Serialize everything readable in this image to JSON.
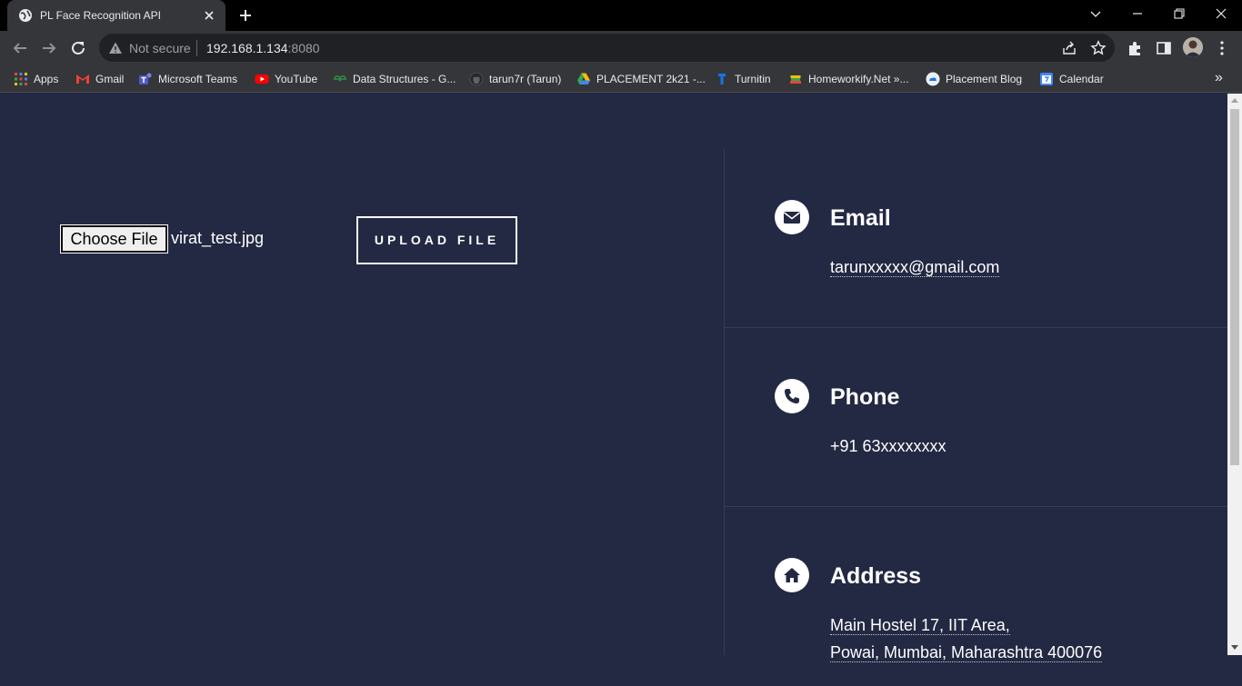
{
  "browser": {
    "tab_title": "PL Face Recognition API",
    "security_label": "Not secure",
    "url_host": "192.168.1.134",
    "url_port": ":8080",
    "bookmarks": [
      {
        "label": "Apps",
        "icon": "apps-grid-icon"
      },
      {
        "label": "Gmail",
        "icon": "gmail-icon"
      },
      {
        "label": "Microsoft Teams",
        "icon": "teams-icon"
      },
      {
        "label": "YouTube",
        "icon": "youtube-icon"
      },
      {
        "label": "Data Structures - G...",
        "icon": "gfg-icon"
      },
      {
        "label": "tarun7r (Tarun)",
        "icon": "github-icon"
      },
      {
        "label": "PLACEMENT 2k21 -...",
        "icon": "drive-icon"
      },
      {
        "label": "Turnitin",
        "icon": "turnitin-icon"
      },
      {
        "label": "Homeworkify.Net »...",
        "icon": "books-icon"
      },
      {
        "label": "Placement Blog",
        "icon": "blog-icon"
      },
      {
        "label": "Calendar",
        "icon": "calendar-icon"
      }
    ]
  },
  "upload": {
    "choose_label": "Choose File",
    "file_name": "virat_test.jpg",
    "upload_label": "UPLOAD FILE"
  },
  "contact": {
    "email": {
      "title": "Email",
      "value": "tarunxxxxx@gmail.com"
    },
    "phone": {
      "title": "Phone",
      "value": "+91 63xxxxxxxx"
    },
    "address": {
      "title": "Address",
      "line1": "Main Hostel 17, IIT Area,",
      "line2": "Powai, Mumbai, Maharashtra 400076"
    }
  },
  "colors": {
    "page_bg": "#232843",
    "browser_dark": "#35363a",
    "accent_white": "#ffffff"
  }
}
